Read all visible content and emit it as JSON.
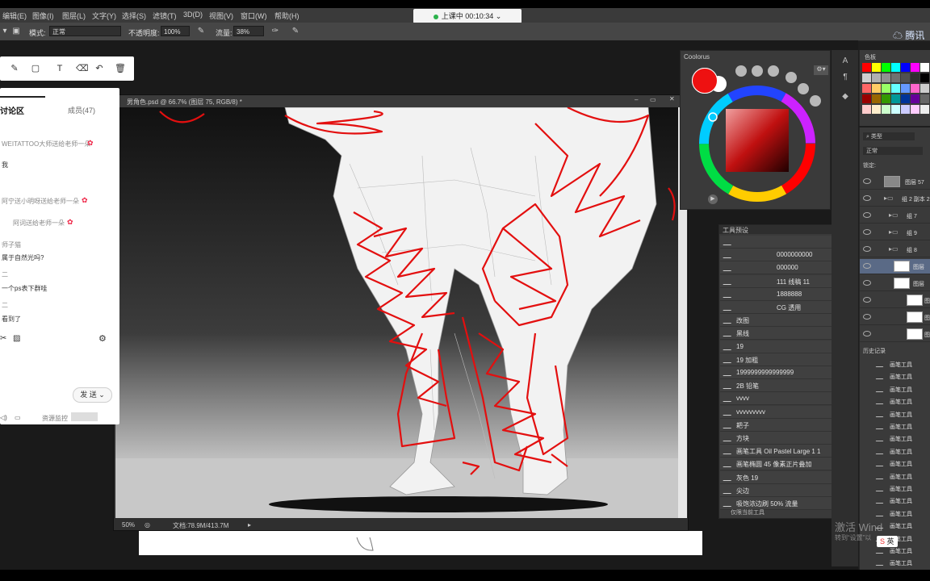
{
  "menu": {
    "items": [
      "编辑(E)",
      "图像(I)",
      "图层(L)",
      "文字(Y)",
      "选择(S)",
      "滤镜(T)",
      "3D(D)",
      "视图(V)",
      "窗口(W)",
      "帮助(H)"
    ]
  },
  "meeting": {
    "status": "上课中 00:10:34"
  },
  "options_bar": {
    "mode_label": "模式:",
    "mode_value": "正常",
    "opacity_label": "不透明度:",
    "opacity_value": "100%",
    "flow_label": "流量:",
    "flow_value": "38%"
  },
  "brand": {
    "name": "腾讯"
  },
  "document": {
    "tab_title": "男角色.psd @ 66.7% (图层 75, RGB/8) *",
    "zoom": "50%",
    "doc_size": "文档:78.9M/413.7M"
  },
  "chat": {
    "title": "讨论区",
    "members": "成员(47)",
    "messages": [
      "WEITATTOO大师送给老师一朵",
      "我",
      "阿宁送小明呀送给老师一朵",
      "阿词送给老师一朵",
      "师子猫",
      "属于自然光吗?",
      "二",
      "一个ps表下群哇",
      "二",
      "看到了"
    ],
    "send_label": "发 送",
    "monitor_label": "资源监控"
  },
  "coolorus": {
    "title": "Coolorus",
    "fg_color": "#ee1111",
    "bg_color": "#ffffff"
  },
  "presets": {
    "title": "工具预设",
    "items": [
      "",
      "0000000000",
      "000000",
      "111 线稿 11",
      "1888888",
      "CG 透用",
      "改图",
      "黑线",
      "19",
      "19 加粗",
      "1999999999999999",
      "2B 铅笔",
      "vvvv",
      "vvvvvvvvv",
      "耙子",
      "方块",
      "画笔工具 Oil Pastel Large 1 1",
      "画笔椭圆 45 像素正片叠加",
      "灰色 19",
      "尖边",
      "吸饱浓边刷 50% 流量"
    ],
    "footer": "仅限当前工具"
  },
  "swatches": {
    "title": "色板",
    "colors": [
      "#ff0000",
      "#ffff00",
      "#00ff00",
      "#00ffff",
      "#0000ff",
      "#ff00ff",
      "#ffffff",
      "#d0d0d0",
      "#b0b0b0",
      "#909090",
      "#707070",
      "#505050",
      "#303030",
      "#000000",
      "#ff6666",
      "#ffcc66",
      "#99ff66",
      "#66ffff",
      "#6699ff",
      "#ff66cc",
      "#cccccc",
      "#990000",
      "#996600",
      "#339900",
      "#009999",
      "#003399",
      "#660099",
      "#666666",
      "#ffcccc",
      "#ffeecc",
      "#ccffcc",
      "#ccffff",
      "#ccccff",
      "#ffccff",
      "#eeeeee"
    ]
  },
  "layers": {
    "kind_label": "类型",
    "blend": "正常",
    "lock_label": "锁定:",
    "rows": [
      "图层 57",
      "组 2 副本 2",
      "组 7",
      "组 9",
      "组 8",
      "图层",
      "图层",
      "图",
      "图",
      "图"
    ]
  },
  "history": {
    "title": "历史记录",
    "items": [
      "画笔工具",
      "画笔工具",
      "画笔工具",
      "画笔工具",
      "画笔工具",
      "画笔工具",
      "画笔工具",
      "画笔工具",
      "画笔工具",
      "画笔工具",
      "画笔工具",
      "画笔工具",
      "画笔工具",
      "画笔工具",
      "画笔工具",
      "画笔工具",
      "画笔工具"
    ]
  },
  "watermark": {
    "line1": "激活 Wind",
    "line2": "转到“设置”以"
  },
  "ime": {
    "label": "英"
  }
}
